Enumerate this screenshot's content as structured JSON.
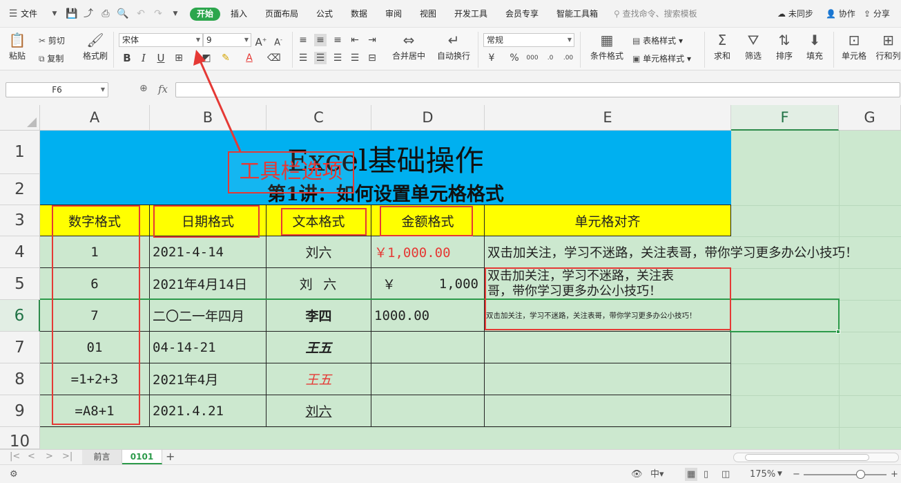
{
  "menubar": {
    "file_label": "文件",
    "tabs": [
      "开始",
      "插入",
      "页面布局",
      "公式",
      "数据",
      "审阅",
      "视图",
      "开发工具",
      "会员专享",
      "智能工具箱"
    ],
    "search_placeholder": "查找命令、搜索模板",
    "unsync": "未同步",
    "collab": "协作",
    "share": "分享"
  },
  "ribbon": {
    "paste": "粘贴",
    "cut": "剪切",
    "copy": "复制",
    "format_painter": "格式刷",
    "font_name": "宋体",
    "font_size": "9",
    "merge_center": "合并居中",
    "wrap_text": "自动换行",
    "number_format": "常规",
    "conditional_format": "条件格式",
    "table_style": "表格样式",
    "cell_style": "单元格样式",
    "sum": "求和",
    "filter": "筛选",
    "sort": "排序",
    "fill": "填充",
    "cell": "单元格",
    "row_col": "行和列",
    "currency_symbol": "¥",
    "percent_symbol": "%",
    "thousands_symbol": "000"
  },
  "formula_bar": {
    "name_box": "F6",
    "fx": "fx",
    "formula": ""
  },
  "sheet": {
    "columns": [
      "A",
      "B",
      "C",
      "D",
      "E",
      "F",
      "G"
    ],
    "rows": [
      "1",
      "2",
      "3",
      "4",
      "5",
      "6",
      "7",
      "8",
      "9",
      "10"
    ],
    "title": "Excel基础操作",
    "subtitle": "第1讲：如何设置单元格格式",
    "headers": [
      "数字格式",
      "日期格式",
      "文本格式",
      "金额格式",
      "单元格对齐"
    ],
    "A": [
      "1",
      "6",
      "7",
      "01",
      "=1+2+3",
      "=A8+1"
    ],
    "B": [
      "2021-4-14",
      "2021年4月14日",
      "二〇二一年四月",
      "04-14-21",
      "2021年4月",
      "2021.4.21"
    ],
    "C": [
      "刘六",
      "刘 六",
      "李四",
      "王五",
      "王五",
      "刘六"
    ],
    "D4": "￥1,000.00",
    "D5_symbol": "￥",
    "D5_value": "1,000",
    "D6": "1000.00",
    "E4": "双击加关注，学习不迷路，关注表哥，带你学习更多办公小技巧！",
    "E5_line1": "双击加关注，学习不迷路，关注表",
    "E5_line2": "哥，带你学习更多办公小技巧！",
    "E6": "双击加关注，学习不迷路，关注表哥，带你学习更多办公小技巧！"
  },
  "annotation": {
    "label": "工具栏选项",
    "color": "#e53935"
  },
  "tabs": {
    "sheets": [
      "前言",
      "0101"
    ],
    "active": "0101",
    "add": "+"
  },
  "status": {
    "zoom": "175%"
  },
  "colors": {
    "title_bg": "#00b0f0",
    "header_bg": "#ffff00",
    "sheet_bg": "#cce8cf",
    "accent": "#2ca64c",
    "red_text": "#e53935"
  }
}
